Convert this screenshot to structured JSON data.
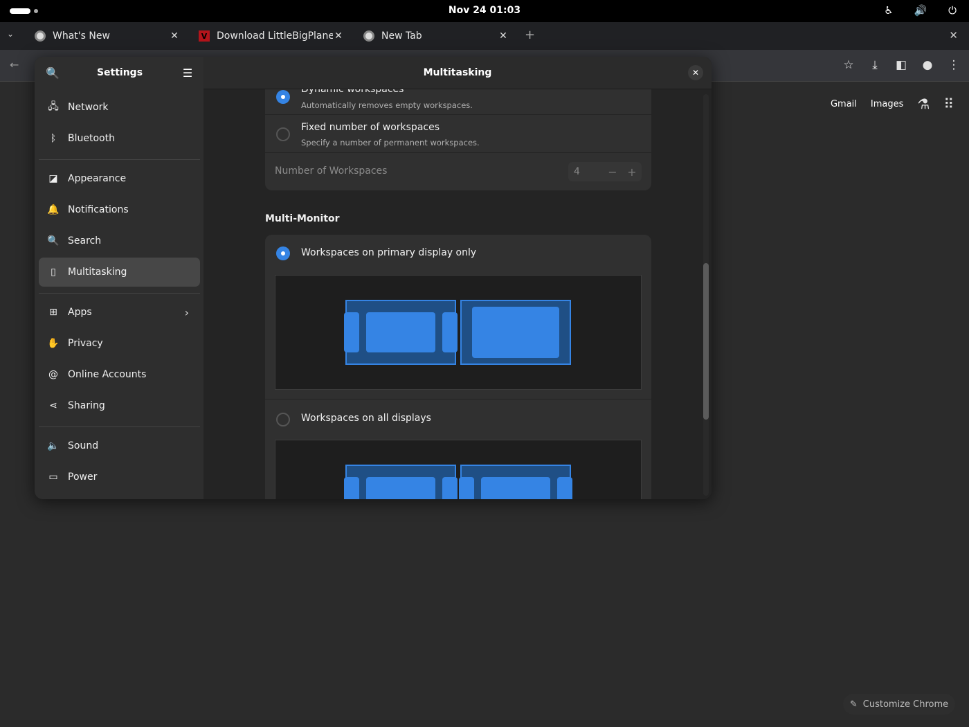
{
  "topbar": {
    "clock": "Nov 24  01:03",
    "icons": [
      "accessibility-icon",
      "volume-icon",
      "power-icon"
    ]
  },
  "tabs": [
    {
      "title": "What's New",
      "icon": "chrome-icon"
    },
    {
      "title": "Download LittleBigPlanet",
      "icon": "site-favicon"
    },
    {
      "title": "New Tab",
      "icon": "chrome-icon"
    }
  ],
  "new_tab_symbol": "+",
  "close_symbol": "✕",
  "google": {
    "gmail": "Gmail",
    "images": "Images",
    "customize": "Customize Chrome"
  },
  "settings": {
    "title": "Settings",
    "page_title": "Multitasking",
    "sidebar": [
      {
        "label": "Network",
        "icon": "network-icon"
      },
      {
        "label": "Bluetooth",
        "icon": "bluetooth-icon"
      },
      {
        "label": "Appearance",
        "icon": "appearance-icon"
      },
      {
        "label": "Notifications",
        "icon": "bell-icon"
      },
      {
        "label": "Search",
        "icon": "search-icon"
      },
      {
        "label": "Multitasking",
        "icon": "multitasking-icon",
        "active": true
      },
      {
        "label": "Apps",
        "icon": "apps-icon"
      },
      {
        "label": "Privacy",
        "icon": "hand-icon"
      },
      {
        "label": "Online Accounts",
        "icon": "at-icon"
      },
      {
        "label": "Sharing",
        "icon": "share-icon"
      },
      {
        "label": "Sound",
        "icon": "speaker-icon"
      },
      {
        "label": "Power",
        "icon": "battery-icon"
      }
    ],
    "workspaces": {
      "dynamic_label": "Dynamic workspaces",
      "dynamic_sub": "Automatically removes empty workspaces.",
      "fixed_label": "Fixed number of workspaces",
      "fixed_sub": "Specify a number of permanent workspaces.",
      "count_label": "Number of Workspaces",
      "count_value": "4",
      "minus": "−",
      "plus": "+",
      "selected": "dynamic"
    },
    "multi_monitor": {
      "title": "Multi-Monitor",
      "primary_label": "Workspaces on primary display only",
      "all_label": "Workspaces on all displays",
      "selected": "primary"
    }
  }
}
